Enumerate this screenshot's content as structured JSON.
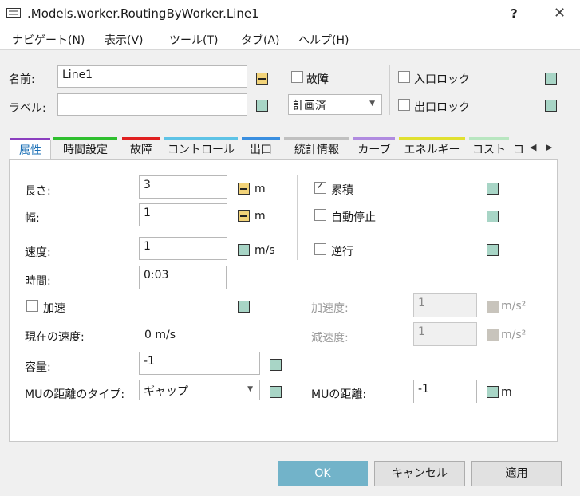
{
  "window": {
    "title": ".Models.worker.RoutingByWorker.Line1",
    "help": "?",
    "close": "✕"
  },
  "menu": [
    "ナビゲート(N)",
    "表示(V)",
    "ツール(T)",
    "タブ(A)",
    "ヘルプ(H)"
  ],
  "header": {
    "name_label": "名前:",
    "name_value": "Line1",
    "label_label": "ラベル:",
    "label_value": "",
    "failure_label": "故障",
    "failure_checked": false,
    "plan_select": "計画済",
    "entry_lock_label": "入口ロック",
    "entry_lock_checked": false,
    "exit_lock_label": "出口ロック",
    "exit_lock_checked": false
  },
  "tabs": [
    {
      "label": "属性",
      "color": "#8b3fbf",
      "active": true
    },
    {
      "label": "時間設定",
      "color": "#2fbf2f"
    },
    {
      "label": "故障",
      "color": "#e02020"
    },
    {
      "label": "コントロール",
      "color": "#5ec3e6"
    },
    {
      "label": "出口",
      "color": "#3a8fe0"
    },
    {
      "label": "統計情報",
      "color": "#c0c0c0"
    },
    {
      "label": "カーブ",
      "color": "#b08be0"
    },
    {
      "label": "エネルギー",
      "color": "#e0e030"
    },
    {
      "label": "コスト",
      "color": "#b8e6c0"
    },
    {
      "label": "コ",
      "color": "#808080"
    }
  ],
  "attrs": {
    "length_label": "長さ:",
    "length_value": "3",
    "length_unit": "m",
    "width_label": "幅:",
    "width_value": "1",
    "width_unit": "m",
    "speed_label": "速度:",
    "speed_value": "1",
    "speed_unit": "m/s",
    "time_label": "時間:",
    "time_value": "0:03",
    "accel_label": "加速",
    "accel_checked": false,
    "current_speed_label": "現在の速度:",
    "current_speed_value": "0 m/s",
    "capacity_label": "容量:",
    "capacity_value": "-1",
    "mu_distance_type_label": "MUの距離のタイプ:",
    "mu_distance_type_value": "ギャップ",
    "accumulate_label": "累積",
    "accumulate_checked": true,
    "auto_stop_label": "自動停止",
    "auto_stop_checked": false,
    "reverse_label": "逆行",
    "reverse_checked": false,
    "acceleration_label": "加速度:",
    "acceleration_value": "1",
    "acceleration_unit": "m/s²",
    "deceleration_label": "減速度:",
    "deceleration_value": "1",
    "deceleration_unit": "m/s²",
    "mu_distance_label": "MUの距離:",
    "mu_distance_value": "-1",
    "mu_distance_unit": "m"
  },
  "buttons": {
    "ok": "OK",
    "cancel": "キャンセル",
    "apply": "適用"
  }
}
